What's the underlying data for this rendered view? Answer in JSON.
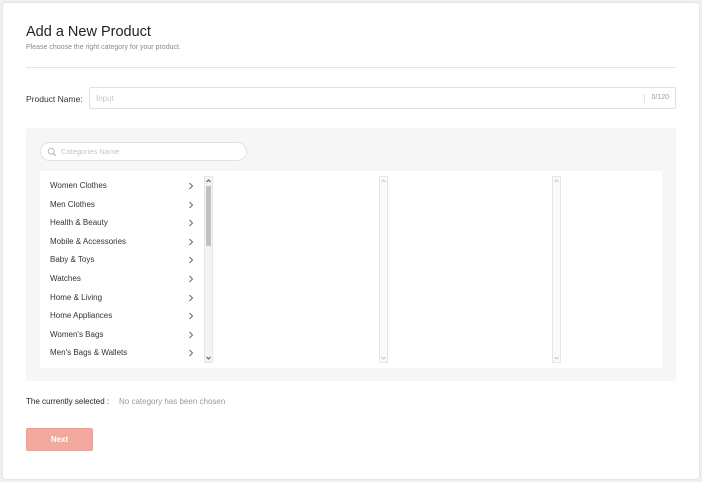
{
  "header": {
    "title": "Add a New Product",
    "subtitle": "Please choose the right category for your product."
  },
  "product_name": {
    "label": "Product Name:",
    "placeholder": "Input",
    "value": "",
    "counter": "0/120"
  },
  "category_search": {
    "placeholder": "Categories Name",
    "icon": "search-icon"
  },
  "categories": [
    {
      "label": "Women Clothes"
    },
    {
      "label": "Men Clothes"
    },
    {
      "label": "Health & Beauty"
    },
    {
      "label": "Mobile & Accessories"
    },
    {
      "label": "Baby & Toys"
    },
    {
      "label": "Watches"
    },
    {
      "label": "Home & Living"
    },
    {
      "label": "Home Appliances"
    },
    {
      "label": "Women's Bags"
    },
    {
      "label": "Men's Bags & Wallets"
    }
  ],
  "selection": {
    "label": "The currently selected :",
    "value": "No category has been chosen"
  },
  "actions": {
    "next_label": "Next"
  },
  "colors": {
    "accent": "#f3a99d",
    "page_background": "#f0f0f0",
    "panel_background": "#f6f6f6"
  }
}
